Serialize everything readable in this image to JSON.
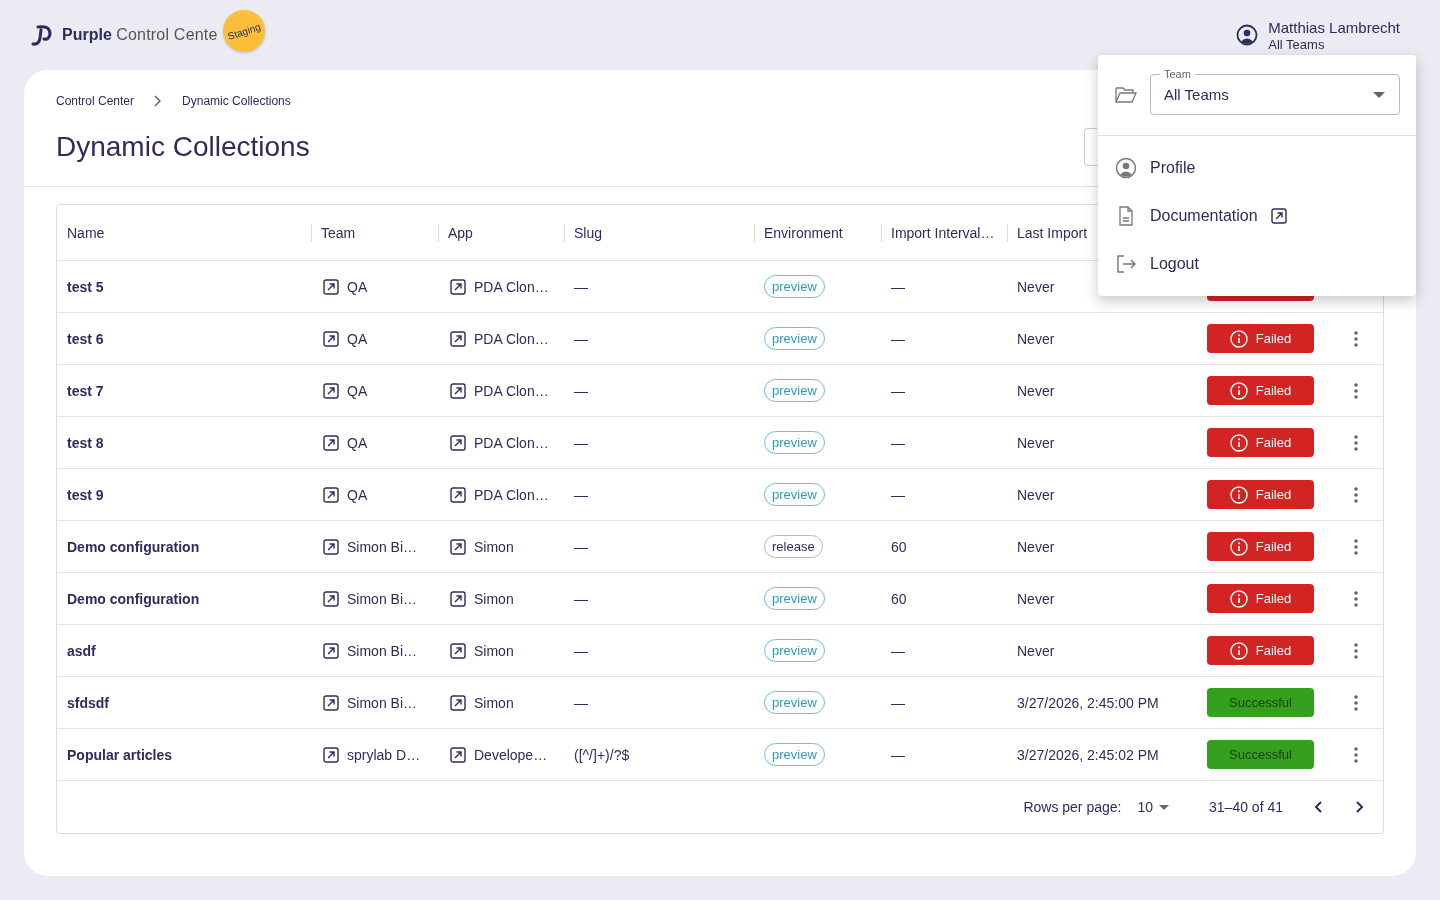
{
  "brand": {
    "name_bold": "Purple",
    "name_rest": "Control Cente",
    "badge": "Staging"
  },
  "user": {
    "name": "Matthias Lambrecht",
    "team": "All Teams"
  },
  "breadcrumb": [
    "Control Center",
    "Dynamic Collections"
  ],
  "title": "Dynamic Collections",
  "table": {
    "columns": [
      "Name",
      "Team",
      "App",
      "Slug",
      "Environment",
      "Import Interval…",
      "Last Import"
    ],
    "rows": [
      {
        "name": "test 5",
        "team": "QA",
        "app": "PDA Clon…",
        "slug": "—",
        "environment": "preview",
        "interval": "—",
        "last_import": "Never",
        "status": {
          "kind": "failed"
        }
      },
      {
        "name": "test 6",
        "team": "QA",
        "app": "PDA Clon…",
        "slug": "—",
        "environment": "preview",
        "interval": "—",
        "last_import": "Never",
        "status": {
          "kind": "failed",
          "label": "Failed"
        }
      },
      {
        "name": "test 7",
        "team": "QA",
        "app": "PDA Clon…",
        "slug": "—",
        "environment": "preview",
        "interval": "—",
        "last_import": "Never",
        "status": {
          "kind": "failed",
          "label": "Failed"
        }
      },
      {
        "name": "test 8",
        "team": "QA",
        "app": "PDA Clon…",
        "slug": "—",
        "environment": "preview",
        "interval": "—",
        "last_import": "Never",
        "status": {
          "kind": "failed",
          "label": "Failed"
        }
      },
      {
        "name": "test 9",
        "team": "QA",
        "app": "PDA Clon…",
        "slug": "—",
        "environment": "preview",
        "interval": "—",
        "last_import": "Never",
        "status": {
          "kind": "failed",
          "label": "Failed"
        }
      },
      {
        "name": "Demo configuration",
        "team": "Simon Bi…",
        "app": "Simon",
        "slug": "—",
        "environment": "release",
        "interval": "60",
        "last_import": "Never",
        "status": {
          "kind": "failed",
          "label": "Failed"
        }
      },
      {
        "name": "Demo configuration",
        "team": "Simon Bi…",
        "app": "Simon",
        "slug": "—",
        "environment": "preview",
        "interval": "60",
        "last_import": "Never",
        "status": {
          "kind": "failed",
          "label": "Failed"
        }
      },
      {
        "name": "asdf",
        "team": "Simon Bi…",
        "app": "Simon",
        "slug": "—",
        "environment": "preview",
        "interval": "—",
        "last_import": "Never",
        "status": {
          "kind": "failed",
          "label": "Failed"
        }
      },
      {
        "name": "sfdsdf",
        "team": "Simon Bi…",
        "app": "Simon",
        "slug": "—",
        "environment": "preview",
        "interval": "—",
        "last_import": "3/27/2026, 2:45:00 PM",
        "status": {
          "kind": "successful",
          "label": "Successful"
        }
      },
      {
        "name": "Popular articles",
        "team": "sprylab D…",
        "app": "Develope…",
        "slug": "([^/]+)/?$",
        "environment": "preview",
        "interval": "—",
        "last_import": "3/27/2026, 2:45:02 PM",
        "status": {
          "kind": "successful",
          "label": "Successful"
        }
      }
    ]
  },
  "pagination": {
    "rows_per_page_label": "Rows per page:",
    "rows_per_page": "10",
    "range": "31–40 of 41"
  },
  "user_menu": {
    "team_field": {
      "label": "Team",
      "value": "All Teams"
    },
    "items": [
      {
        "kind": "profile",
        "label": "Profile"
      },
      {
        "kind": "documentation",
        "label": "Documentation",
        "external": true
      },
      {
        "kind": "logout",
        "label": "Logout"
      }
    ]
  }
}
